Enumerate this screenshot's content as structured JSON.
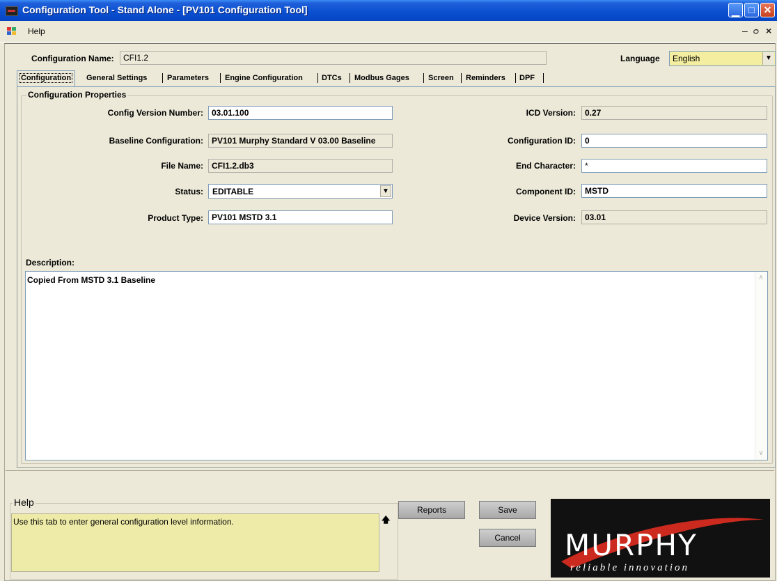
{
  "window": {
    "title": "Configuration Tool - Stand Alone - [PV101 Configuration Tool]",
    "controls": {
      "minimize": "_",
      "maximize": "□",
      "close": "X"
    }
  },
  "menu": {
    "help": "Help",
    "mdi_minimize": "_",
    "mdi_restore": "ᴘ",
    "mdi_close": "x"
  },
  "header": {
    "config_name_label": "Configuration Name:",
    "config_name_value": "CFI1.2",
    "language_label": "Language",
    "language_value": "English"
  },
  "tabs": [
    {
      "label": "Configuration",
      "active": true
    },
    {
      "label": "General Settings"
    },
    {
      "label": "Parameters"
    },
    {
      "label": "Engine Configuration"
    },
    {
      "label": "DTCs"
    },
    {
      "label": "Modbus Gages"
    },
    {
      "label": "Screen"
    },
    {
      "label": "Reminders"
    },
    {
      "label": "DPF"
    }
  ],
  "properties": {
    "group_title": "Configuration Properties",
    "left": [
      {
        "label": "Config Version Number:",
        "value": "03.01.100"
      },
      {
        "label": "Baseline Configuration:",
        "value": "PV101 Murphy Standard V 03.00 Baseline"
      },
      {
        "label": "File Name:",
        "value": "CFI1.2.db3"
      },
      {
        "label": "Status:",
        "value": "EDITABLE"
      },
      {
        "label": "Product Type:",
        "value": "PV101 MSTD 3.1"
      }
    ],
    "right": [
      {
        "label": "ICD Version:",
        "value": "0.27"
      },
      {
        "label": "Configuration ID:",
        "value": "0"
      },
      {
        "label": "End Character:",
        "value": "*"
      },
      {
        "label": "Component ID:",
        "value": "MSTD"
      },
      {
        "label": "Device Version:",
        "value": "03.01"
      }
    ],
    "description_label": "Description:",
    "description_value": "Copied From MSTD 3.1 Baseline"
  },
  "help": {
    "title": "Help",
    "text": "Use this tab to enter general configuration level information."
  },
  "buttons": {
    "reports": "Reports",
    "save": "Save",
    "cancel": "Cancel"
  },
  "logo": {
    "brand": "MURPHY",
    "tagline": "reliable innovation"
  },
  "colors": {
    "titlebar": "#0a4fd0",
    "help_bg": "#eeeba8",
    "language_bg": "#f3eea0",
    "logo_bg": "#111111",
    "logo_accent": "#cc2a1e"
  }
}
